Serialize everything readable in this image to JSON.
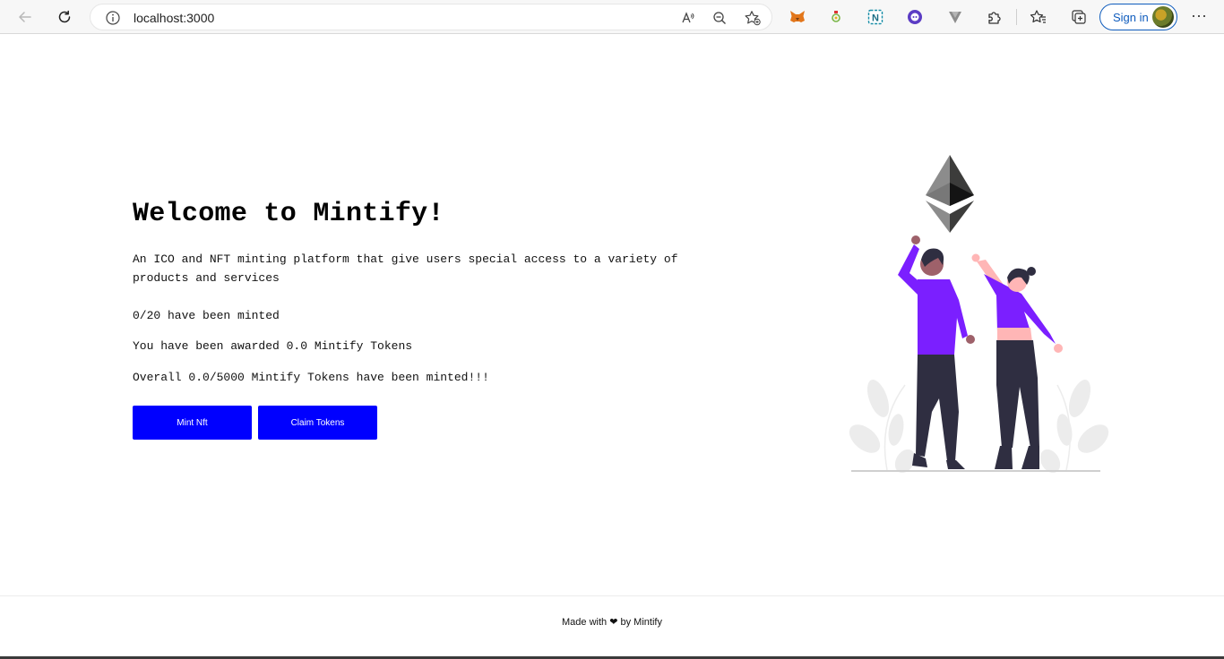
{
  "browser": {
    "url": "localhost:3000",
    "signin_label": "Sign in",
    "icons": {
      "back": "arrow-left-icon",
      "reload": "reload-icon",
      "info": "info-icon",
      "read_aloud": "read-aloud-icon",
      "zoom": "zoom-out-icon",
      "favorite": "add-favorite-icon",
      "extensions": [
        "metamask-icon",
        "extension-icon",
        "notion-icon",
        "extension-purple-icon",
        "vee-icon",
        "puzzle-icon"
      ],
      "favorites": "favorites-icon",
      "collections": "collections-icon",
      "more": "more-icon"
    },
    "more_label": "···"
  },
  "hero": {
    "title": "Welcome to Mintify!",
    "description": "An ICO and NFT minting platform that give users special access to a variety of products and services",
    "minted_status": "0/20 have been minted",
    "awarded_status": "You have been awarded 0.0 Mintify Tokens",
    "overall_status": "Overall 0.0/5000 Mintify Tokens have been minted!!!",
    "mint_button": "Mint Nft",
    "claim_button": "Claim Tokens"
  },
  "footer": {
    "prefix": "Made with",
    "heart": "❤",
    "suffix": "by Mintify"
  },
  "colors": {
    "button_bg": "#0000ff",
    "accent_purple": "#7b1fff",
    "signin_blue": "#0f5cbd"
  }
}
